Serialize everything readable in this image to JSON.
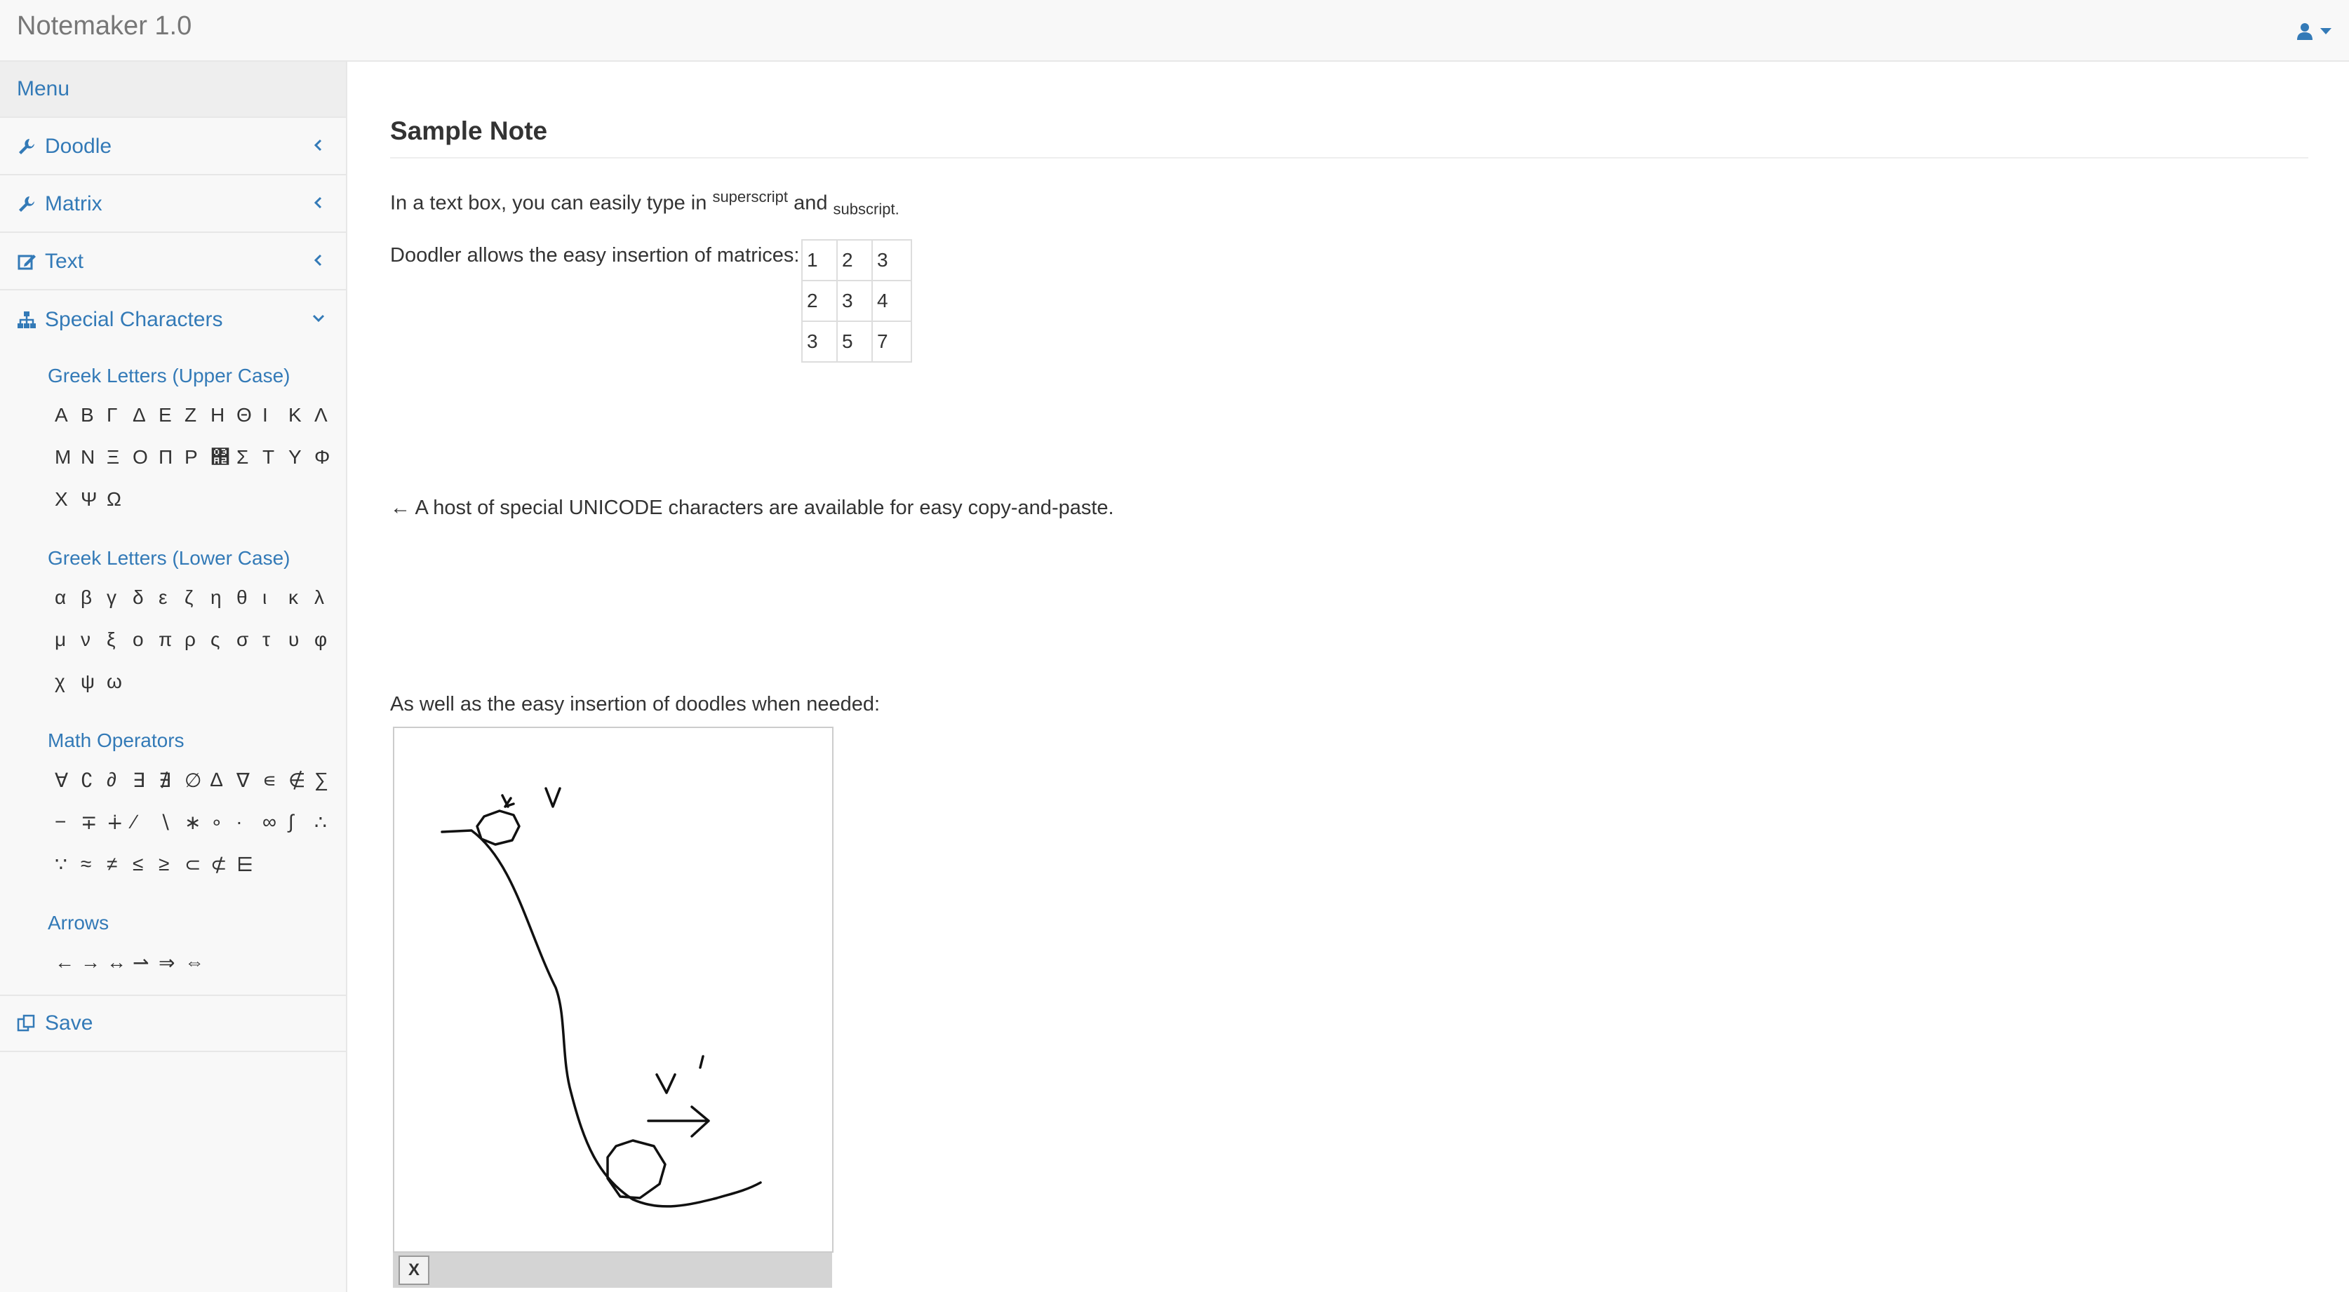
{
  "app": {
    "title": "Notemaker 1.0"
  },
  "header": {
    "user_icon": "user-icon",
    "caret_icon": "caret-down-icon"
  },
  "colors": {
    "link": "#337ab7",
    "navbar_bg": "#f8f8f8",
    "border": "#e7e7e7",
    "text": "#333333"
  },
  "sidebar": {
    "menu_label": "Menu",
    "items": [
      {
        "label": "Doodle",
        "icon": "wrench-icon",
        "chevron": "chevron-left-icon"
      },
      {
        "label": "Matrix",
        "icon": "wrench-icon",
        "chevron": "chevron-left-icon"
      },
      {
        "label": "Text",
        "icon": "edit-icon",
        "chevron": "chevron-left-icon"
      },
      {
        "label": "Special Characters",
        "icon": "sitemap-icon",
        "chevron": "chevron-down-icon"
      }
    ],
    "special_characters": {
      "greek_upper": {
        "title": "Greek Letters (Upper Case)",
        "rows": [
          [
            "Α",
            "Β",
            "Γ",
            "Δ",
            "Ε",
            "Ζ",
            "Η",
            "Θ",
            "Ι",
            "Κ",
            "Λ"
          ],
          [
            "Μ",
            "Ν",
            "Ξ",
            "Ο",
            "Π",
            "Ρ",
            "΢",
            "Σ",
            "Τ",
            "Υ",
            "Φ"
          ],
          [
            "Χ",
            "Ψ",
            "Ω"
          ]
        ]
      },
      "greek_lower": {
        "title": "Greek Letters (Lower Case)",
        "rows": [
          [
            "α",
            "β",
            "γ",
            "δ",
            "ε",
            "ζ",
            "η",
            "θ",
            "ι",
            "κ",
            "λ"
          ],
          [
            "μ",
            "ν",
            "ξ",
            "ο",
            "π",
            "ρ",
            "ς",
            "σ",
            "τ",
            "υ",
            "φ"
          ],
          [
            "χ",
            "ψ",
            "ω"
          ]
        ]
      },
      "math_operators": {
        "title": "Math Operators",
        "rows": [
          [
            "∀",
            "∁",
            "∂",
            "∃",
            "∄",
            "∅",
            "∆",
            "∇",
            "∊",
            "∉",
            "∑"
          ],
          [
            "−",
            "∓",
            "∔",
            "∕",
            "∖",
            "∗",
            "∘",
            "∙",
            "∞",
            "∫",
            "∴"
          ],
          [
            "∵",
            "≈",
            "≠",
            "≤",
            "≥",
            "⊂",
            "⊄",
            "⋿"
          ]
        ]
      },
      "arrows": {
        "title": "Arrows",
        "rows": [
          [
            "←",
            "→",
            "↔",
            "⇀",
            "⇒",
            "⇔"
          ]
        ]
      }
    },
    "save": {
      "label": "Save",
      "icon": "copy-icon"
    }
  },
  "note": {
    "title": "Sample Note",
    "line1": {
      "before": "In a text box, you can easily type in ",
      "sup": "superscript",
      "middle": " and ",
      "sub": "subscript."
    },
    "line2": "Doodler allows the easy insertion of matrices:",
    "matrix": [
      [
        "1",
        "2",
        "3"
      ],
      [
        "2",
        "3",
        "4"
      ],
      [
        "3",
        "5",
        "7"
      ]
    ],
    "line3": "← A host of special UNICODE characters are available for easy copy-and-paste.",
    "line4": "As well as the easy insertion of doodles when needed:",
    "doodle_clear_label": "X"
  }
}
